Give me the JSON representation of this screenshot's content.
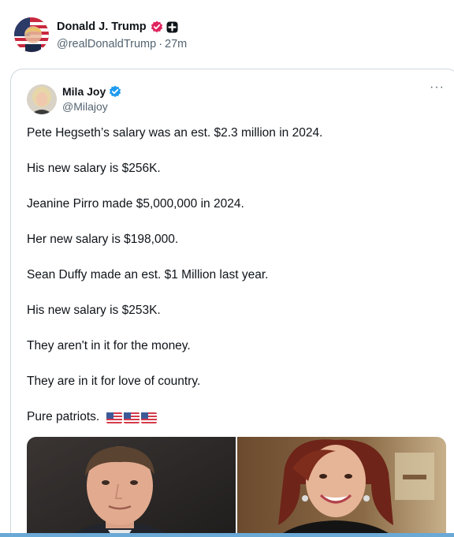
{
  "outer_post": {
    "author_name": "Donald J. Trump",
    "author_handle": "@realDonaldTrump",
    "separator": "·",
    "time_ago": "27m",
    "badges": [
      "gov-verified-badge",
      "subscriber-plus-badge"
    ]
  },
  "quoted_post": {
    "author_name": "Mila Joy",
    "author_handle": "@Milajoy",
    "more_label": "···",
    "lines": [
      "Pete Hegseth’s salary was an est. $2.3 million in 2024.",
      "His new salary is $256K.",
      "Jeanine Pirro made $5,000,000 in 2024.",
      "Her new salary is $198,000.",
      "Sean Duffy made an est. $1 Million last year.",
      "His new salary is $253K.",
      "They aren't in it for the money.",
      "They are in it for love of country."
    ],
    "closing_text": "Pure patriots.",
    "closing_emoji": [
      "us-flag-icon",
      "us-flag-icon",
      "us-flag-icon"
    ],
    "media": [
      {
        "name": "photo-man-in-suit"
      },
      {
        "name": "photo-woman-smiling"
      }
    ]
  },
  "colors": {
    "text": "#0f1419",
    "secondary": "#536471",
    "border": "#cfd9de",
    "verified_blue": "#1d9bf0",
    "gov_badge": "#e0245e",
    "bottom_strip": "#6aa9d6"
  }
}
